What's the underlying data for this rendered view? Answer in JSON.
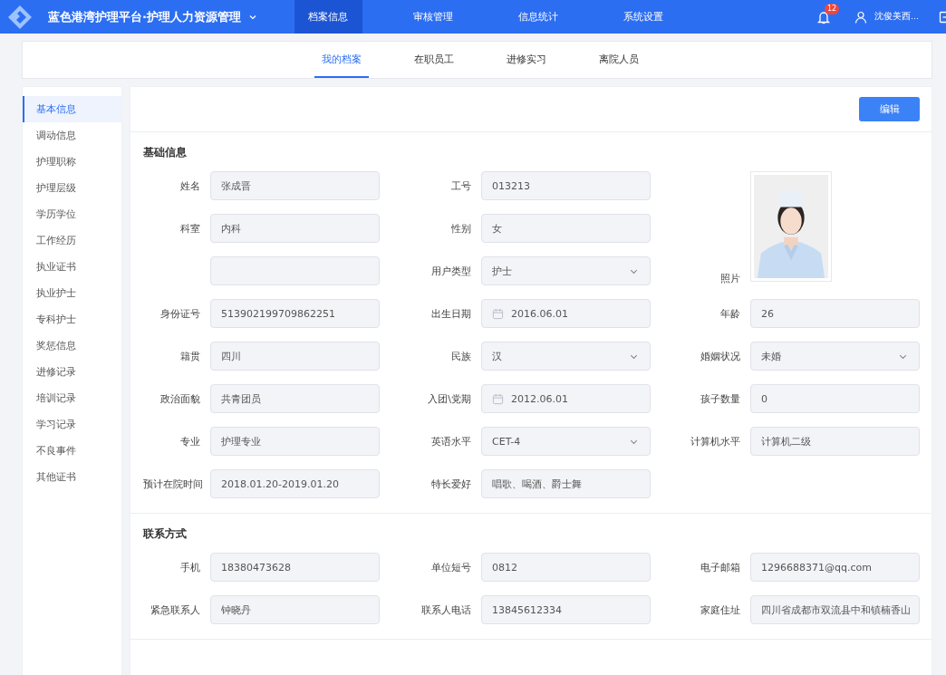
{
  "header": {
    "title": "蓝色港湾护理平台·护理人力资源管理",
    "nav": [
      {
        "label": "档案信息",
        "selected": true
      },
      {
        "label": "审核管理",
        "selected": false
      },
      {
        "label": "信息统计",
        "selected": false
      },
      {
        "label": "系统设置",
        "selected": false
      }
    ],
    "notifications": "12",
    "user": "沈俊美西..."
  },
  "subtabs": [
    {
      "label": "我的档案",
      "selected": true
    },
    {
      "label": "在职员工",
      "selected": false
    },
    {
      "label": "进修实习",
      "selected": false
    },
    {
      "label": "离院人员",
      "selected": false
    }
  ],
  "sidebar": {
    "items": [
      {
        "label": "基本信息",
        "selected": true
      },
      {
        "label": "调动信息",
        "selected": false
      },
      {
        "label": "护理职称",
        "selected": false
      },
      {
        "label": "护理层级",
        "selected": false
      },
      {
        "label": "学历学位",
        "selected": false
      },
      {
        "label": "工作经历",
        "selected": false
      },
      {
        "label": "执业证书",
        "selected": false
      },
      {
        "label": "执业护士",
        "selected": false
      },
      {
        "label": "专科护士",
        "selected": false
      },
      {
        "label": "奖惩信息",
        "selected": false
      },
      {
        "label": "进修记录",
        "selected": false
      },
      {
        "label": "培训记录",
        "selected": false
      },
      {
        "label": "学习记录",
        "selected": false
      },
      {
        "label": "不良事件",
        "selected": false
      },
      {
        "label": "其他证书",
        "selected": false
      }
    ]
  },
  "edit_button": "编辑",
  "sections": [
    {
      "title": "基础信息",
      "fields": [
        {
          "kind": "text",
          "label": "姓名",
          "value": "张成晋"
        },
        {
          "kind": "text",
          "label": "工号",
          "value": "013213"
        },
        {
          "label": "照片"
        },
        {
          "kind": "text",
          "label": "科室",
          "value": "内科"
        },
        {
          "kind": "text",
          "label": "性别",
          "value": "女"
        },
        {
          "kind": "text"
        },
        {
          "kind": "select",
          "label": "用户类型",
          "value": "护士"
        },
        {
          "kind": "text",
          "label": "身份证号",
          "value": "513902199709862251"
        },
        {
          "kind": "date",
          "label": "出生日期",
          "value": "2016.06.01"
        },
        {
          "kind": "text",
          "label": "年龄",
          "value": "26"
        },
        {
          "kind": "text",
          "label": "籍贯",
          "value": "四川"
        },
        {
          "kind": "select",
          "label": "民族",
          "value": "汉"
        },
        {
          "kind": "select",
          "label": "婚姻状况",
          "value": "未婚"
        },
        {
          "kind": "text",
          "label": "政治面貌",
          "value": "共青团员"
        },
        {
          "kind": "date",
          "label": "入团\\党期",
          "value": "2012.06.01"
        },
        {
          "kind": "text",
          "label": "孩子数量",
          "value": "0"
        },
        {
          "kind": "text",
          "label": "专业",
          "value": "护理专业"
        },
        {
          "kind": "select",
          "label": "英语水平",
          "value": "CET-4"
        },
        {
          "kind": "text",
          "label": "计算机水平",
          "value": "计算机二级"
        },
        {
          "kind": "text",
          "label": "预计在院时间",
          "value": "2018.01.20-2019.01.20"
        },
        {
          "kind": "text",
          "label": "特长爱好",
          "value": "唱歌、喝酒、爵士舞"
        }
      ]
    },
    {
      "title": "联系方式",
      "fields": [
        {
          "kind": "text",
          "label": "手机",
          "value": "18380473628"
        },
        {
          "kind": "text",
          "label": "单位短号",
          "value": "0812"
        },
        {
          "kind": "text",
          "label": "电子邮箱",
          "value": "1296688371@qq.com"
        },
        {
          "kind": "text",
          "label": "紧急联系人",
          "value": "钟晓丹"
        },
        {
          "kind": "text",
          "label": "联系人电话",
          "value": "13845612334"
        },
        {
          "kind": "text",
          "label": "家庭住址",
          "value": "四川省成都市双流县中和镇楠香山"
        }
      ]
    }
  ]
}
